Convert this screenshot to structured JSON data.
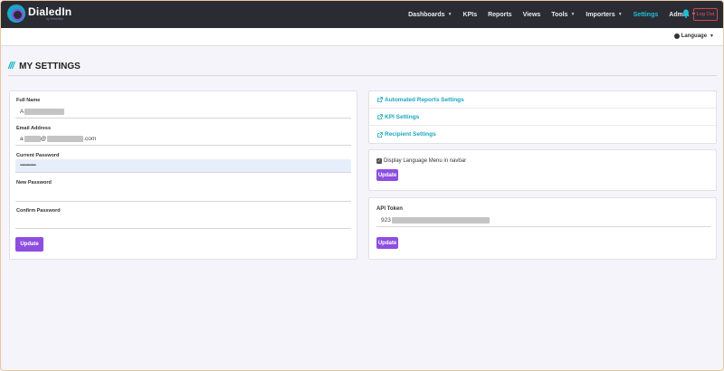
{
  "brand": {
    "name": "DialedIn",
    "subtitle": "by Rebellion"
  },
  "nav": {
    "items": [
      {
        "label": "Dashboards",
        "dropdown": true
      },
      {
        "label": "KPIs",
        "dropdown": false
      },
      {
        "label": "Reports",
        "dropdown": false
      },
      {
        "label": "Views",
        "dropdown": false
      },
      {
        "label": "Tools",
        "dropdown": true
      },
      {
        "label": "Importers",
        "dropdown": true
      },
      {
        "label": "Settings",
        "dropdown": false,
        "active": true
      },
      {
        "label": "Admin",
        "dropdown": true
      }
    ],
    "logout_label": "Log Out",
    "bell_icon": "bell-icon"
  },
  "subbar": {
    "language_label": "Language"
  },
  "page": {
    "title": "MY SETTINGS"
  },
  "profile_form": {
    "full_name_label": "Full Name",
    "full_name_value": "A",
    "email_label": "Email Address",
    "email_prefix": "a",
    "email_at": "@",
    "email_suffix": ".com",
    "current_password_label": "Current Password",
    "current_password_value": "••••••••••••••",
    "new_password_label": "New Password",
    "confirm_password_label": "Confirm Password",
    "update_label": "Update"
  },
  "settings_links": [
    {
      "label": "Automated Reports Settings"
    },
    {
      "label": "KPI Settings"
    },
    {
      "label": "Recipient Settings"
    }
  ],
  "language_option": {
    "checkbox_label": "Display Language Menu in navbar",
    "checked": true,
    "update_label": "Update"
  },
  "api": {
    "label": "API Token",
    "token_prefix": "923",
    "update_label": "Update"
  },
  "colors": {
    "navbar": "#2b2c33",
    "accent_cyan": "#1ec0d6",
    "button_purple": "#8d4ee0",
    "logout_red": "#d9434e"
  }
}
